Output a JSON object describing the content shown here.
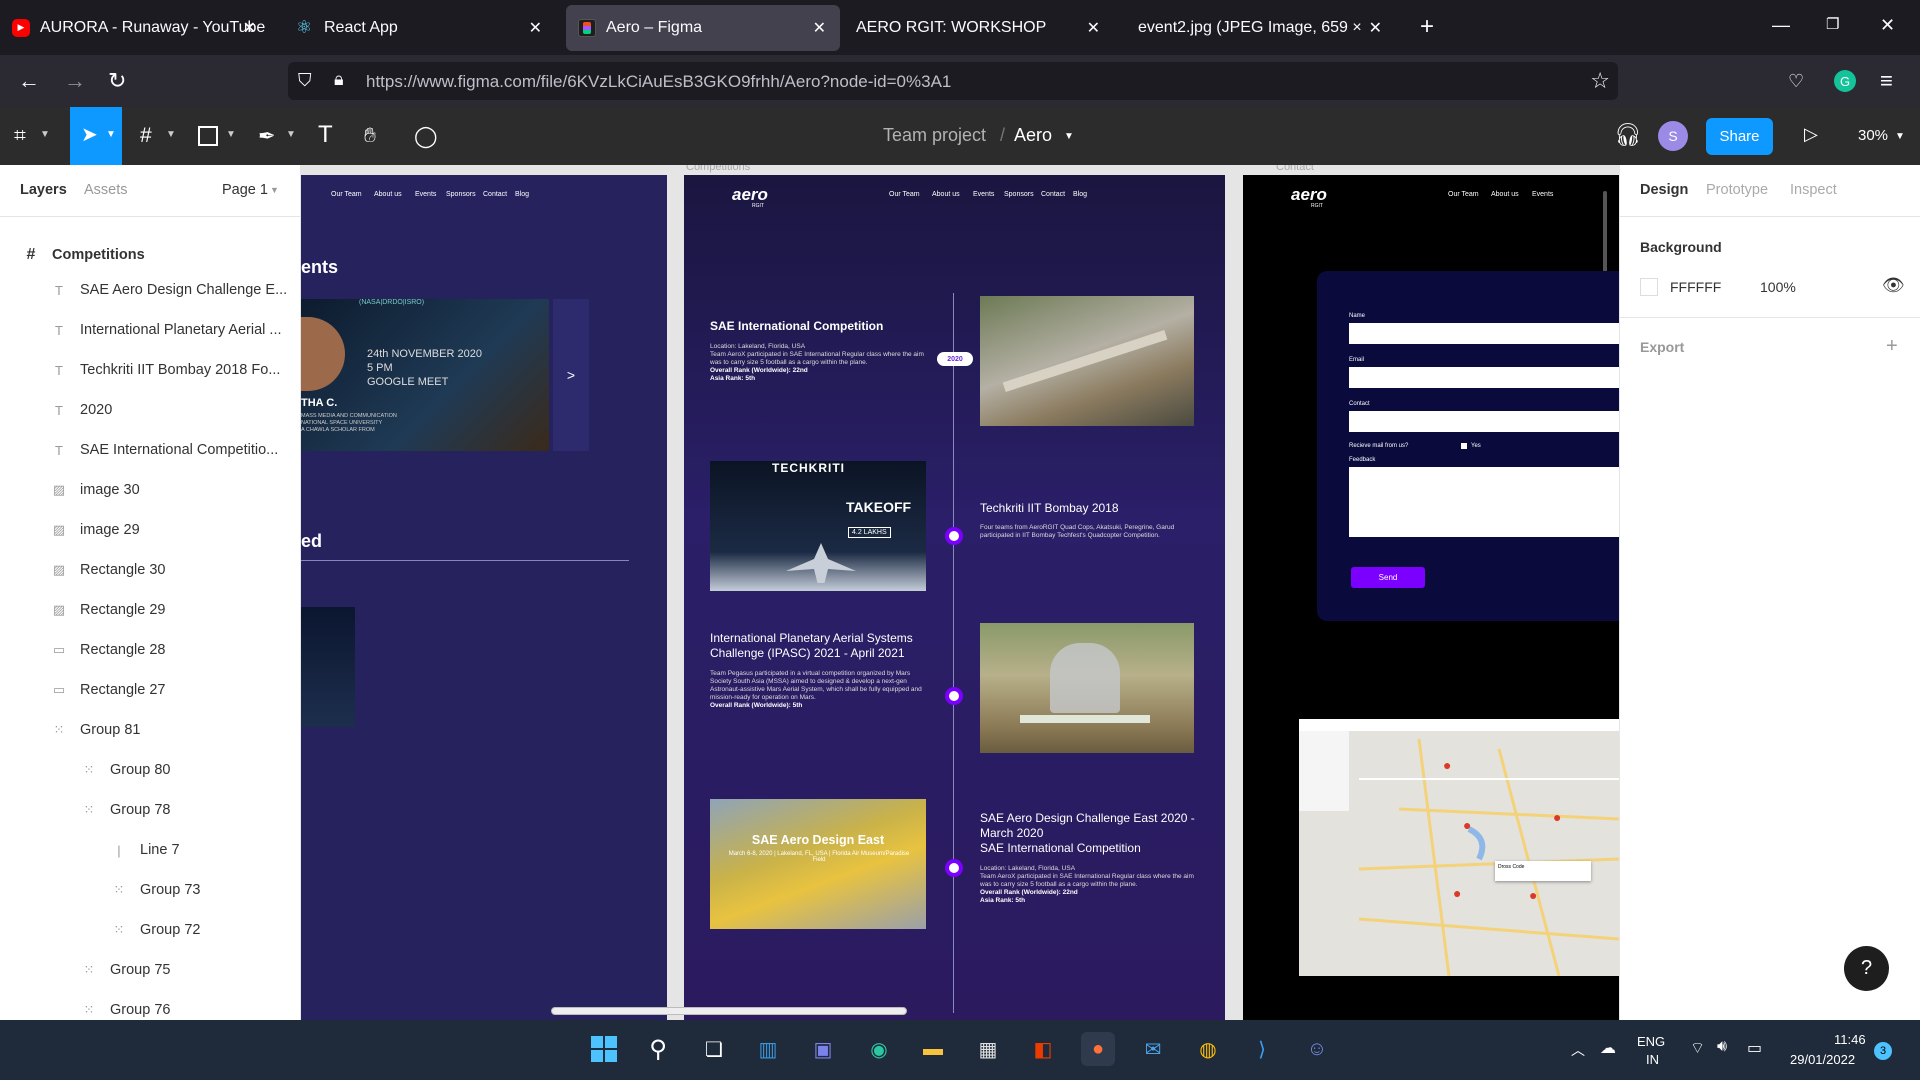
{
  "browser": {
    "tabs": [
      {
        "label": "AURORA - Runaway - YouTube",
        "favicon": "youtube-icon"
      },
      {
        "label": "React App",
        "favicon": "react-icon"
      },
      {
        "label": "Aero – Figma",
        "favicon": "figma-icon",
        "active": true
      },
      {
        "label": "AERO RGIT: WORKSHOP",
        "favicon": ""
      },
      {
        "label": "event2.jpg (JPEG Image, 659 × 465 p",
        "favicon": ""
      }
    ],
    "url": "https://www.figma.com/file/6KVzLkCiAuEsB3GKO9frhh/Aero?node-id=0%3A1",
    "url_domain": "figma.com"
  },
  "figma": {
    "project": "Team project",
    "separator": "/",
    "file": "Aero",
    "avatar_initial": "S",
    "share_label": "Share",
    "zoom": "30%"
  },
  "left_panel": {
    "tabs": [
      "Layers",
      "Assets"
    ],
    "page": "Page 1",
    "frame": "Competitions",
    "layers": [
      {
        "icon": "T",
        "name": "SAE Aero Design Challenge E..."
      },
      {
        "icon": "T",
        "name": "International Planetary Aerial ..."
      },
      {
        "icon": "T",
        "name": "Techkriti IIT Bombay 2018 Fo..."
      },
      {
        "icon": "T",
        "name": "2020"
      },
      {
        "icon": "T",
        "name": "SAE International Competitio..."
      },
      {
        "icon": "img",
        "name": "image 30"
      },
      {
        "icon": "img",
        "name": "image 29"
      },
      {
        "icon": "img",
        "name": "Rectangle 30"
      },
      {
        "icon": "img",
        "name": "Rectangle 29"
      },
      {
        "icon": "rect",
        "name": "Rectangle 28"
      },
      {
        "icon": "rect",
        "name": "Rectangle 27"
      },
      {
        "icon": "group",
        "name": "Group 81"
      },
      {
        "icon": "group",
        "name": "Group 80"
      },
      {
        "icon": "group",
        "name": "Group 78"
      },
      {
        "icon": "line",
        "name": "Line 7"
      },
      {
        "icon": "group",
        "name": "Group 73"
      },
      {
        "icon": "group",
        "name": "Group 72"
      },
      {
        "icon": "group",
        "name": "Group 75"
      },
      {
        "icon": "group",
        "name": "Group 76"
      }
    ]
  },
  "right_panel": {
    "tabs": [
      "Design",
      "Prototype",
      "Inspect"
    ],
    "background_label": "Background",
    "bg_hex": "FFFFFF",
    "bg_opacity": "100%",
    "export_label": "Export"
  },
  "canvas": {
    "frame_labels": [
      "Competitions",
      "Contact"
    ],
    "site_nav": [
      "Our Team",
      "About us",
      "Events",
      "Sponsors",
      "Contact",
      "Blog"
    ],
    "frame1": {
      "heading_partial": "ents",
      "heading2_partial": "ed",
      "event_org": "(NASA|DRDO|ISRO)",
      "event_date": "24th NOVEMBER 2020",
      "event_time": "5 PM",
      "event_platform": "GOOGLE MEET",
      "speaker_partial": "THA C.",
      "speaker_info": "MASS MEDIA AND COMMUNICATION\nNATIONAL SPACE UNIVERSITY\nA CHAWLA SCHOLAR FROM",
      "next_arrow": ">"
    },
    "frame2": {
      "logo": "aero",
      "logo_sub": "RGIT",
      "year_badge": "2020",
      "entries": [
        {
          "title": "SAE International Competition",
          "body": "Location: Lakeland, Florida, USA\nTeam AeroX participated in SAE International Regular class where the aim was to carry size 5 football as a cargo within the plane.",
          "bullets": [
            "Overall Rank (Worldwide): 22nd",
            "Asia Rank: 5th"
          ]
        },
        {
          "title": "Techkriti IIT Bombay 2018",
          "body": "Four teams from AeroRGIT Quad Cops, Akatsuki, Peregrine, Garud participated in IIT Bombay Techfest's Quadcopter Competition.",
          "bullets": []
        },
        {
          "title": "International Planetary Aerial Systems Challenge (IPASC) 2021 - April 2021",
          "body": "Team Pegasus participated in a virtual competition organized by Mars Society South Asia (MSSA) aimed to designed & develop a next-gen Astronaut-assistive Mars Aerial System, which shall be fully equipped and mission-ready for operation on Mars.",
          "bullets": [
            "Overall Rank (Worldwide): 5th"
          ]
        },
        {
          "title": "SAE Aero Design Challenge East 2020 - March 2020\nSAE International Competition",
          "body": "Location: Lakeland, Florida, USA\nTeam AeroX participated in SAE International Regular class where the aim was to carry size 5 football as a cargo within the plane.",
          "bullets": [
            "Overall Rank (Worldwide): 22nd",
            "Asia Rank: 5th"
          ]
        }
      ],
      "poster_techkriti": "TECHKRITI",
      "poster_takeoff": "TAKEOFF",
      "poster_prize": "4.2 LAKHS",
      "poster_sae": "SAE Aero Design East",
      "poster_sae_sub": "March 6-8, 2020 | Lakeland, FL, USA | Florida Air Museum/Paradise Field"
    },
    "frame3": {
      "logo": "aero",
      "logo_sub": "RGIT",
      "form_labels": [
        "Name",
        "Email",
        "Contact"
      ],
      "mail_question": "Recieve mail from us?",
      "mail_yes": "Yes",
      "feedback_label": "Feedback",
      "send_label": "Send",
      "map_search": "Dross Code"
    }
  },
  "taskbar": {
    "lang": "ENG",
    "region": "IN",
    "time": "11:46",
    "date": "29/01/2022",
    "notifications": "3"
  },
  "help_label": "?",
  "colors": {
    "accent": "#0d99ff",
    "frame_bg": "#1e1a4d",
    "purple": "#7b00ff"
  }
}
